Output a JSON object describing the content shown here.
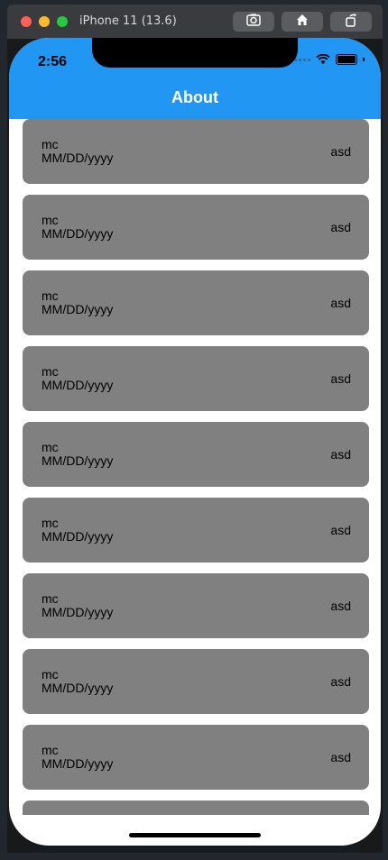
{
  "simulator": {
    "title": "iPhone 11 (13.6)",
    "buttons": [
      "screenshot-icon",
      "home-icon",
      "rotate-icon"
    ]
  },
  "status_bar": {
    "time": "2:56"
  },
  "appbar": {
    "title": "About",
    "color": "#2196f3"
  },
  "list": {
    "card_color": "#808080",
    "items": [
      {
        "name": "mc",
        "date": "MM/DD/yyyy",
        "trailing": "asd"
      },
      {
        "name": "mc",
        "date": "MM/DD/yyyy",
        "trailing": "asd"
      },
      {
        "name": "mc",
        "date": "MM/DD/yyyy",
        "trailing": "asd"
      },
      {
        "name": "mc",
        "date": "MM/DD/yyyy",
        "trailing": "asd"
      },
      {
        "name": "mc",
        "date": "MM/DD/yyyy",
        "trailing": "asd"
      },
      {
        "name": "mc",
        "date": "MM/DD/yyyy",
        "trailing": "asd"
      },
      {
        "name": "mc",
        "date": "MM/DD/yyyy",
        "trailing": "asd"
      },
      {
        "name": "mc",
        "date": "MM/DD/yyyy",
        "trailing": "asd"
      },
      {
        "name": "mc",
        "date": "MM/DD/yyyy",
        "trailing": "asd"
      },
      {
        "name": "",
        "date": "",
        "trailing": ""
      }
    ]
  }
}
